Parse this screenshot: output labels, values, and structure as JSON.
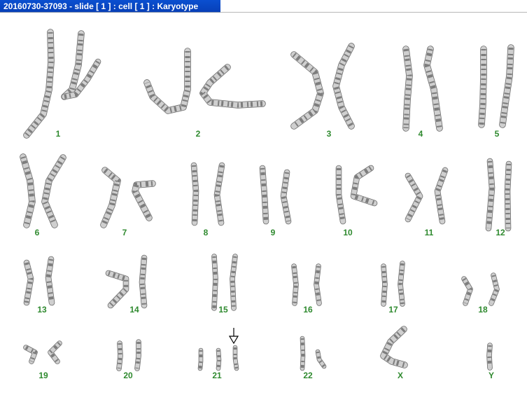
{
  "window": {
    "title": "20160730-37093 - slide [ 1 ] : cell [ 1 ] : Karyotype"
  },
  "karyotype": {
    "labels": [
      "1",
      "2",
      "3",
      "4",
      "5",
      "6",
      "7",
      "8",
      "9",
      "10",
      "11",
      "12",
      "13",
      "14",
      "15",
      "16",
      "17",
      "18",
      "19",
      "20",
      "21",
      "22",
      "X",
      "Y"
    ],
    "label_color": "#2f8a2f",
    "marker": {
      "type": "arrow-down-outline",
      "target": "21"
    }
  }
}
